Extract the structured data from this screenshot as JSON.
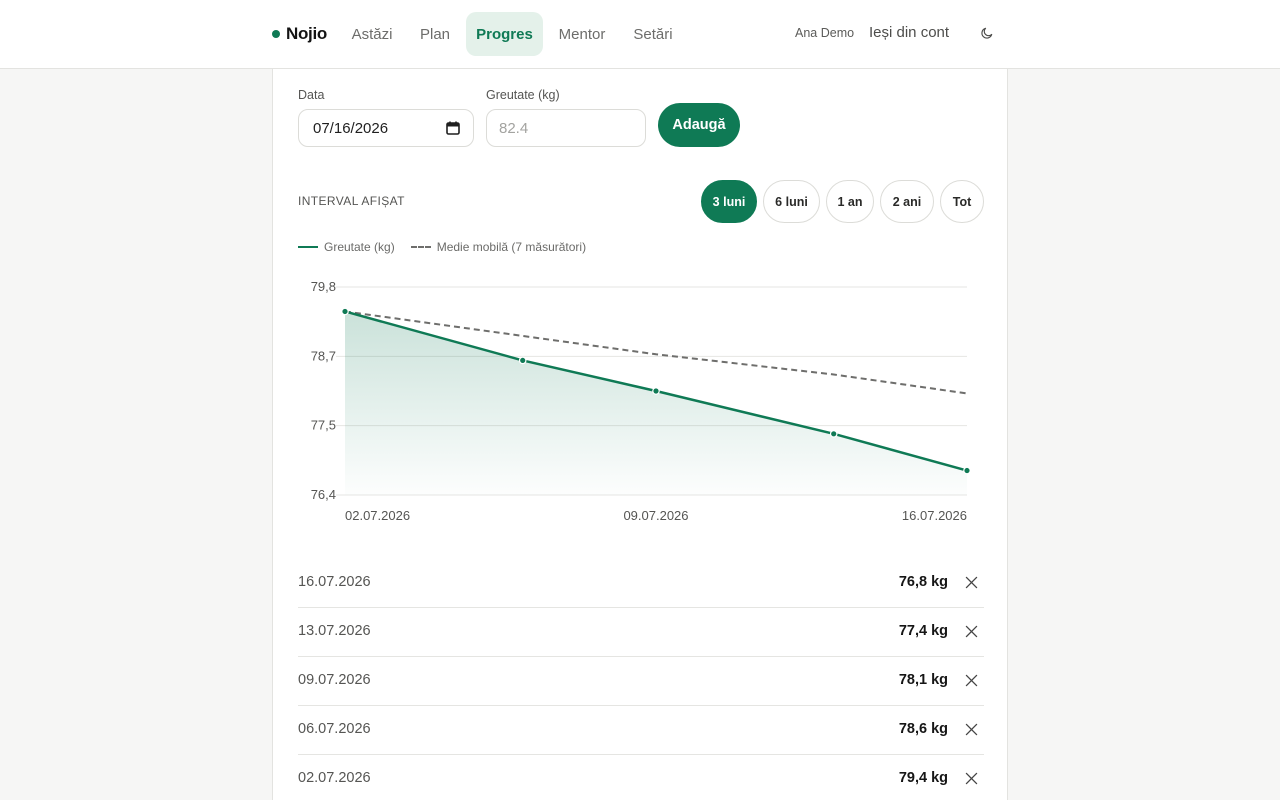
{
  "brand": {
    "name": "Nojio",
    "accent": "#0f7a55"
  },
  "nav": [
    {
      "label": "Astăzi",
      "active": false
    },
    {
      "label": "Plan",
      "active": false
    },
    {
      "label": "Progres",
      "active": true
    },
    {
      "label": "Mentor",
      "active": false
    },
    {
      "label": "Setări",
      "active": false
    }
  ],
  "user": {
    "name": "Ana Demo",
    "logout_label": "Ieși din cont",
    "theme_icon": "moon-icon"
  },
  "form": {
    "date_label": "Data",
    "date_value": "07/16/2026",
    "weight_label": "Greutate (kg)",
    "weight_placeholder": "82.4",
    "weight_value": "",
    "add_label": "Adaugă"
  },
  "interval": {
    "label": "INTERVAL AFIȘAT",
    "options": [
      "3 luni",
      "6 luni",
      "1 an",
      "2 ani",
      "Tot"
    ],
    "selected": "3 luni"
  },
  "chart_data": {
    "type": "line",
    "x": [
      "02.07.2026",
      "06.07.2026",
      "09.07.2026",
      "13.07.2026",
      "16.07.2026"
    ],
    "x_tick_labels": [
      "02.07.2026",
      "09.07.2026",
      "16.07.2026"
    ],
    "y_tick_labels": [
      "79,8",
      "78,7",
      "77,5",
      "76,4"
    ],
    "ylim": [
      76.4,
      79.8
    ],
    "grid": true,
    "legend_position": "top-left",
    "series": [
      {
        "name": "Greutate (kg)",
        "values": [
          79.4,
          78.6,
          78.1,
          77.4,
          76.8
        ],
        "color": "#0f7a55",
        "style": "solid",
        "area_fill": true
      },
      {
        "name": "Medie mobilă (7 măsurători)",
        "values": [
          79.4,
          79.0,
          78.7,
          78.37,
          78.06
        ],
        "color": "#6e6e6c",
        "style": "dashed"
      }
    ]
  },
  "entries": [
    {
      "date": "16.07.2026",
      "value": "76,8 kg"
    },
    {
      "date": "13.07.2026",
      "value": "77,4 kg"
    },
    {
      "date": "09.07.2026",
      "value": "78,1 kg"
    },
    {
      "date": "06.07.2026",
      "value": "78,6 kg"
    },
    {
      "date": "02.07.2026",
      "value": "79,4 kg"
    }
  ]
}
